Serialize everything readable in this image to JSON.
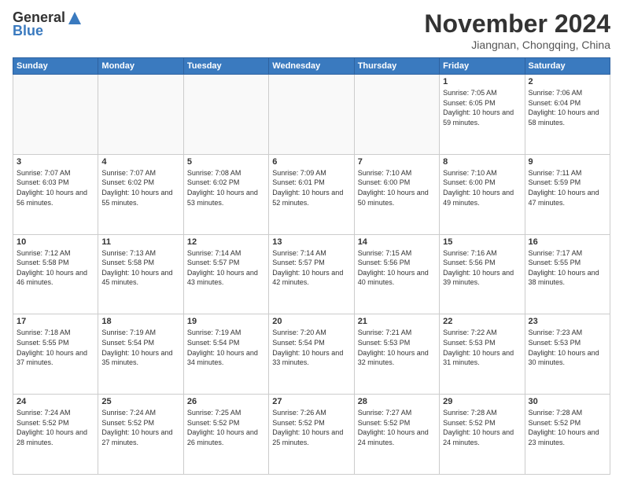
{
  "logo": {
    "general": "General",
    "blue": "Blue"
  },
  "title": "November 2024",
  "location": "Jiangnan, Chongqing, China",
  "days": [
    "Sunday",
    "Monday",
    "Tuesday",
    "Wednesday",
    "Thursday",
    "Friday",
    "Saturday"
  ],
  "weeks": [
    [
      {
        "day": "",
        "content": ""
      },
      {
        "day": "",
        "content": ""
      },
      {
        "day": "",
        "content": ""
      },
      {
        "day": "",
        "content": ""
      },
      {
        "day": "",
        "content": ""
      },
      {
        "day": "1",
        "content": "Sunrise: 7:05 AM\nSunset: 6:05 PM\nDaylight: 10 hours and 59 minutes."
      },
      {
        "day": "2",
        "content": "Sunrise: 7:06 AM\nSunset: 6:04 PM\nDaylight: 10 hours and 58 minutes."
      }
    ],
    [
      {
        "day": "3",
        "content": "Sunrise: 7:07 AM\nSunset: 6:03 PM\nDaylight: 10 hours and 56 minutes."
      },
      {
        "day": "4",
        "content": "Sunrise: 7:07 AM\nSunset: 6:02 PM\nDaylight: 10 hours and 55 minutes."
      },
      {
        "day": "5",
        "content": "Sunrise: 7:08 AM\nSunset: 6:02 PM\nDaylight: 10 hours and 53 minutes."
      },
      {
        "day": "6",
        "content": "Sunrise: 7:09 AM\nSunset: 6:01 PM\nDaylight: 10 hours and 52 minutes."
      },
      {
        "day": "7",
        "content": "Sunrise: 7:10 AM\nSunset: 6:00 PM\nDaylight: 10 hours and 50 minutes."
      },
      {
        "day": "8",
        "content": "Sunrise: 7:10 AM\nSunset: 6:00 PM\nDaylight: 10 hours and 49 minutes."
      },
      {
        "day": "9",
        "content": "Sunrise: 7:11 AM\nSunset: 5:59 PM\nDaylight: 10 hours and 47 minutes."
      }
    ],
    [
      {
        "day": "10",
        "content": "Sunrise: 7:12 AM\nSunset: 5:58 PM\nDaylight: 10 hours and 46 minutes."
      },
      {
        "day": "11",
        "content": "Sunrise: 7:13 AM\nSunset: 5:58 PM\nDaylight: 10 hours and 45 minutes."
      },
      {
        "day": "12",
        "content": "Sunrise: 7:14 AM\nSunset: 5:57 PM\nDaylight: 10 hours and 43 minutes."
      },
      {
        "day": "13",
        "content": "Sunrise: 7:14 AM\nSunset: 5:57 PM\nDaylight: 10 hours and 42 minutes."
      },
      {
        "day": "14",
        "content": "Sunrise: 7:15 AM\nSunset: 5:56 PM\nDaylight: 10 hours and 40 minutes."
      },
      {
        "day": "15",
        "content": "Sunrise: 7:16 AM\nSunset: 5:56 PM\nDaylight: 10 hours and 39 minutes."
      },
      {
        "day": "16",
        "content": "Sunrise: 7:17 AM\nSunset: 5:55 PM\nDaylight: 10 hours and 38 minutes."
      }
    ],
    [
      {
        "day": "17",
        "content": "Sunrise: 7:18 AM\nSunset: 5:55 PM\nDaylight: 10 hours and 37 minutes."
      },
      {
        "day": "18",
        "content": "Sunrise: 7:19 AM\nSunset: 5:54 PM\nDaylight: 10 hours and 35 minutes."
      },
      {
        "day": "19",
        "content": "Sunrise: 7:19 AM\nSunset: 5:54 PM\nDaylight: 10 hours and 34 minutes."
      },
      {
        "day": "20",
        "content": "Sunrise: 7:20 AM\nSunset: 5:54 PM\nDaylight: 10 hours and 33 minutes."
      },
      {
        "day": "21",
        "content": "Sunrise: 7:21 AM\nSunset: 5:53 PM\nDaylight: 10 hours and 32 minutes."
      },
      {
        "day": "22",
        "content": "Sunrise: 7:22 AM\nSunset: 5:53 PM\nDaylight: 10 hours and 31 minutes."
      },
      {
        "day": "23",
        "content": "Sunrise: 7:23 AM\nSunset: 5:53 PM\nDaylight: 10 hours and 30 minutes."
      }
    ],
    [
      {
        "day": "24",
        "content": "Sunrise: 7:24 AM\nSunset: 5:52 PM\nDaylight: 10 hours and 28 minutes."
      },
      {
        "day": "25",
        "content": "Sunrise: 7:24 AM\nSunset: 5:52 PM\nDaylight: 10 hours and 27 minutes."
      },
      {
        "day": "26",
        "content": "Sunrise: 7:25 AM\nSunset: 5:52 PM\nDaylight: 10 hours and 26 minutes."
      },
      {
        "day": "27",
        "content": "Sunrise: 7:26 AM\nSunset: 5:52 PM\nDaylight: 10 hours and 25 minutes."
      },
      {
        "day": "28",
        "content": "Sunrise: 7:27 AM\nSunset: 5:52 PM\nDaylight: 10 hours and 24 minutes."
      },
      {
        "day": "29",
        "content": "Sunrise: 7:28 AM\nSunset: 5:52 PM\nDaylight: 10 hours and 24 minutes."
      },
      {
        "day": "30",
        "content": "Sunrise: 7:28 AM\nSunset: 5:52 PM\nDaylight: 10 hours and 23 minutes."
      }
    ]
  ]
}
